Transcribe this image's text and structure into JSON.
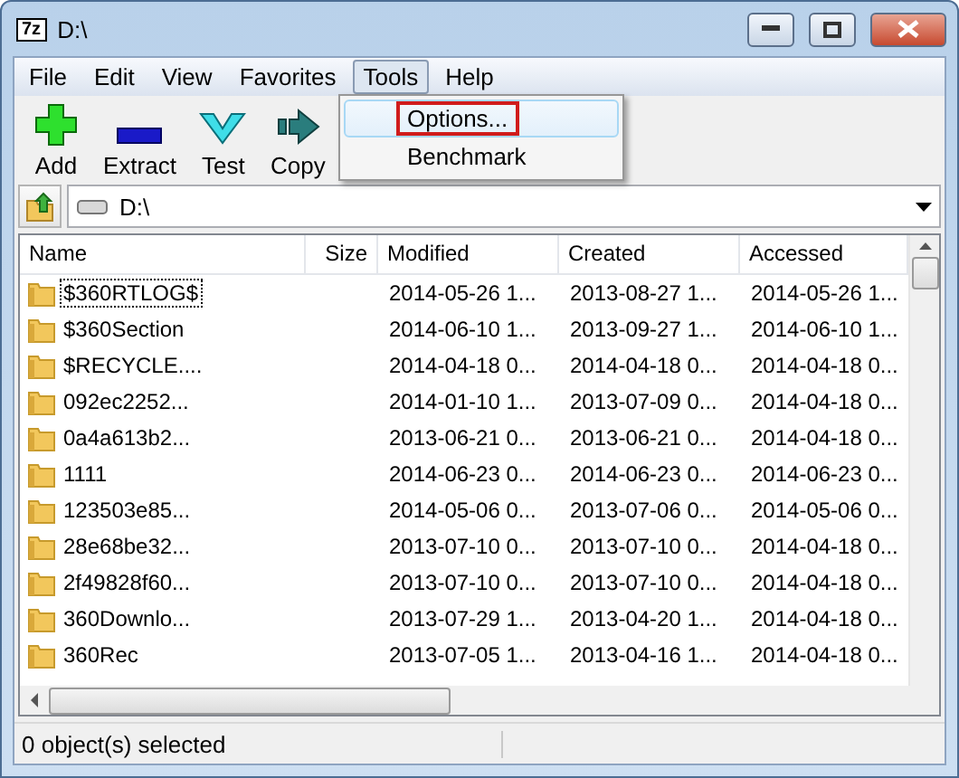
{
  "window": {
    "logo": "7z",
    "title": "D:\\"
  },
  "menu": [
    {
      "label": "File",
      "selected": false
    },
    {
      "label": "Edit",
      "selected": false
    },
    {
      "label": "View",
      "selected": false
    },
    {
      "label": "Favorites",
      "selected": false
    },
    {
      "label": "Tools",
      "selected": true
    },
    {
      "label": "Help",
      "selected": false
    }
  ],
  "dropdown": [
    {
      "label": "Options...",
      "highlighted": true,
      "annotated": true
    },
    {
      "label": "Benchmark",
      "highlighted": false,
      "annotated": false
    }
  ],
  "toolbar": [
    {
      "label": "Add",
      "kind": "add"
    },
    {
      "label": "Extract",
      "kind": "extract"
    },
    {
      "label": "Test",
      "kind": "test"
    },
    {
      "label": "Copy",
      "kind": "copy"
    }
  ],
  "address": {
    "path": "D:\\"
  },
  "table": {
    "columns": [
      "Name",
      "Size",
      "Modified",
      "Created",
      "Accessed"
    ],
    "rows": [
      {
        "name": "$360RTLOG$",
        "focused": true,
        "modified": "2014-05-26 1...",
        "created": "2013-08-27 1...",
        "accessed": "2014-05-26 1..."
      },
      {
        "name": "$360Section",
        "focused": false,
        "modified": "2014-06-10 1...",
        "created": "2013-09-27 1...",
        "accessed": "2014-06-10 1..."
      },
      {
        "name": "$RECYCLE....",
        "focused": false,
        "modified": "2014-04-18 0...",
        "created": "2014-04-18 0...",
        "accessed": "2014-04-18 0..."
      },
      {
        "name": "092ec2252...",
        "focused": false,
        "modified": "2014-01-10 1...",
        "created": "2013-07-09 0...",
        "accessed": "2014-04-18 0..."
      },
      {
        "name": "0a4a613b2...",
        "focused": false,
        "modified": "2013-06-21 0...",
        "created": "2013-06-21 0...",
        "accessed": "2014-04-18 0..."
      },
      {
        "name": "1111",
        "focused": false,
        "modified": "2014-06-23 0...",
        "created": "2014-06-23 0...",
        "accessed": "2014-06-23 0..."
      },
      {
        "name": "123503e85...",
        "focused": false,
        "modified": "2014-05-06 0...",
        "created": "2013-07-06 0...",
        "accessed": "2014-05-06 0..."
      },
      {
        "name": "28e68be32...",
        "focused": false,
        "modified": "2013-07-10 0...",
        "created": "2013-07-10 0...",
        "accessed": "2014-04-18 0..."
      },
      {
        "name": "2f49828f60...",
        "focused": false,
        "modified": "2013-07-10 0...",
        "created": "2013-07-10 0...",
        "accessed": "2014-04-18 0..."
      },
      {
        "name": "360Downlo...",
        "focused": false,
        "modified": "2013-07-29 1...",
        "created": "2013-04-20 1...",
        "accessed": "2014-04-18 0..."
      },
      {
        "name": "360Rec",
        "focused": false,
        "modified": "2013-07-05 1...",
        "created": "2013-04-16 1...",
        "accessed": "2014-04-18 0..."
      }
    ]
  },
  "status_bar": {
    "text": "0 object(s) selected"
  }
}
